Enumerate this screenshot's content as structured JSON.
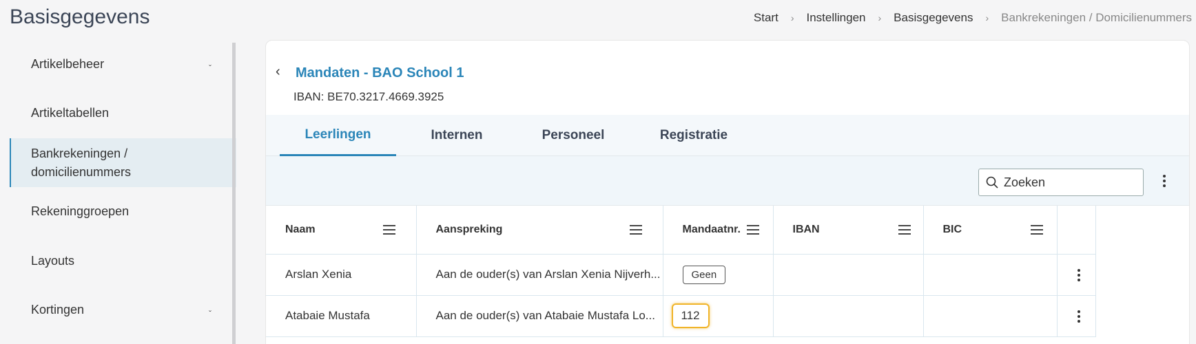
{
  "header": {
    "title": "Basisgegevens",
    "breadcrumb": [
      "Start",
      "Instellingen",
      "Basisgegevens",
      "Bankrekeningen / Domicilienummers"
    ]
  },
  "sidebar": {
    "items": [
      {
        "label": "Artikelbeheer",
        "has_children": true
      },
      {
        "label": "Artikeltabellen"
      },
      {
        "label_line1": "Bankrekeningen /",
        "label_line2": "domicilienummers",
        "active": true
      },
      {
        "label": "Rekeninggroepen"
      },
      {
        "label": "Layouts"
      },
      {
        "label": "Kortingen",
        "has_children": true
      }
    ]
  },
  "card": {
    "title": "Mandaten - BAO School 1",
    "iban": "IBAN: BE70.3217.4669.3925"
  },
  "tabs": [
    {
      "label": "Leerlingen",
      "active": true
    },
    {
      "label": "Internen"
    },
    {
      "label": "Personeel"
    },
    {
      "label": "Registratie"
    }
  ],
  "search": {
    "placeholder": "Zoeken"
  },
  "table": {
    "columns": [
      "Naam",
      "Aanspreking",
      "Mandaatnr.",
      "IBAN",
      "BIC"
    ],
    "rows": [
      {
        "naam": "Arslan Xenia",
        "aanspreking": "Aan de ouder(s) van Arslan Xenia Nijverh...",
        "mandaatnr": "Geen",
        "iban": "",
        "bic": ""
      },
      {
        "naam": "Atabaie Mustafa",
        "aanspreking": "Aan de ouder(s) van Atabaie Mustafa Lo...",
        "mandaatnr": "112",
        "iban": "",
        "bic": ""
      }
    ]
  },
  "colors": {
    "accent": "#2a85b8",
    "highlight": "#f0b429"
  }
}
